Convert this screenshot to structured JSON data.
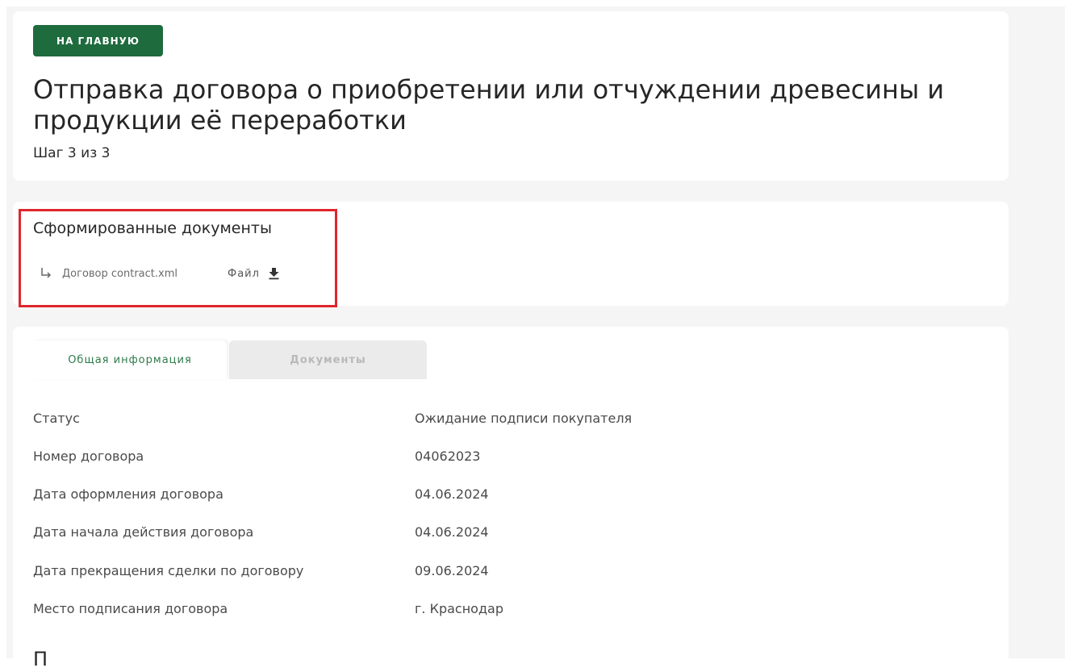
{
  "header": {
    "home_button": "НА ГЛАВНУЮ",
    "title": "Отправка договора о приобретении или отчуждении древесины и продукции её переработки",
    "step": "Шаг 3 из 3"
  },
  "generated_docs": {
    "title": "Сформированные документы",
    "items": [
      {
        "name": "Договор contract.xml",
        "file_label": "Файл",
        "arrow_icon": "subdirectory-arrow-icon",
        "download_icon": "download-icon"
      }
    ]
  },
  "tabs": [
    {
      "label": "Общая информация",
      "active": true
    },
    {
      "label": "Документы",
      "active": false
    }
  ],
  "info": {
    "rows": [
      {
        "label": "Статус",
        "value": "Ожидание подписи покупателя"
      },
      {
        "label": "Номер договора",
        "value": "04062023"
      },
      {
        "label": "Дата оформления договора",
        "value": "04.06.2024"
      },
      {
        "label": "Дата начала действия договора",
        "value": "04.06.2024"
      },
      {
        "label": "Дата прекращения сделки по договору",
        "value": "09.06.2024"
      },
      {
        "label": "Место подписания договора",
        "value": "г. Краснодар"
      }
    ],
    "next_heading": "П"
  },
  "colors": {
    "primary_green": "#1e6b3e",
    "tab_active_text": "#2f7a4a",
    "highlight_red": "#e0262b",
    "page_background": "#f5f5f5"
  }
}
